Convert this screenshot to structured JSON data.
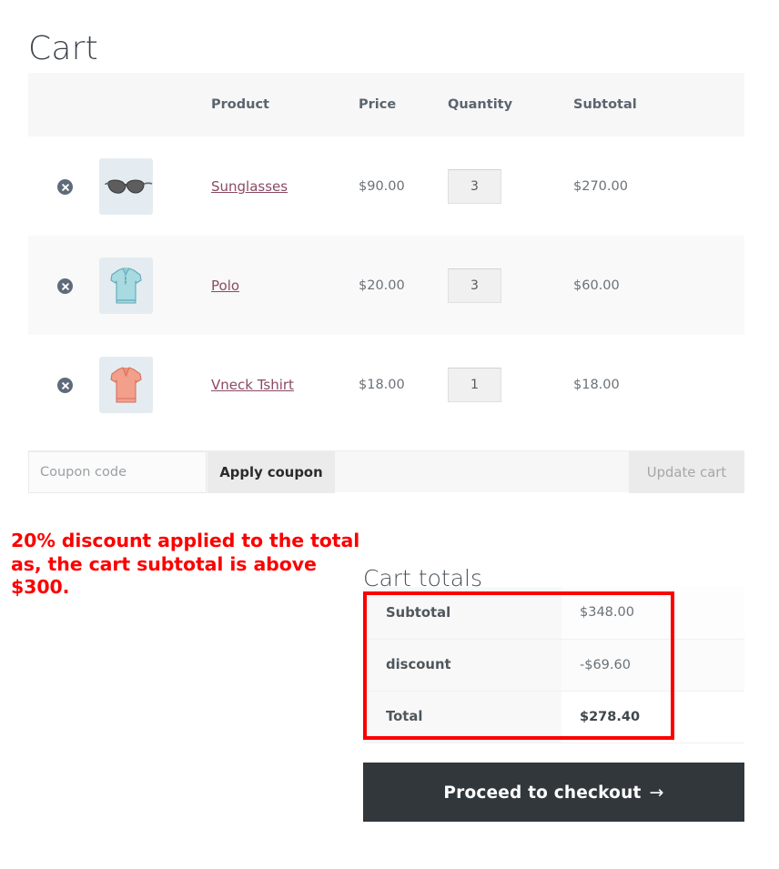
{
  "page": {
    "title": "Cart"
  },
  "cart_table": {
    "columns": [
      "",
      "",
      "Product",
      "Price",
      "Quantity",
      "Subtotal"
    ],
    "headers": {
      "remove": "",
      "thumbnail": "",
      "product": "Product",
      "price": "Price",
      "quantity": "Quantity",
      "subtotal": "Subtotal"
    },
    "rows": [
      {
        "remove_icon": "remove-circle-icon",
        "thumbnail_icon": "sunglasses-thumbnail",
        "name": "Sunglasses",
        "price": "$90.00",
        "quantity": "3",
        "subtotal": "$270.00"
      },
      {
        "remove_icon": "remove-circle-icon",
        "thumbnail_icon": "polo-shirt-thumbnail",
        "name": "Polo",
        "price": "$20.00",
        "quantity": "3",
        "subtotal": "$60.00"
      },
      {
        "remove_icon": "remove-circle-icon",
        "thumbnail_icon": "vneck-tshirt-thumbnail",
        "name": "Vneck Tshirt",
        "price": "$18.00",
        "quantity": "1",
        "subtotal": "$18.00"
      }
    ]
  },
  "actions": {
    "coupon_placeholder": "Coupon code",
    "coupon_value": "",
    "apply_coupon_label": "Apply coupon",
    "update_cart_label": "Update cart"
  },
  "annotation": {
    "text": "20% discount applied to the total as, the cart subtotal is above $300.",
    "color": "#fc0000"
  },
  "cart_totals": {
    "heading": "Cart totals",
    "rows": [
      {
        "label": "Subtotal",
        "value": "$348.00"
      },
      {
        "label": "discount",
        "value": "-$69.60"
      },
      {
        "label": "Total",
        "value": "$278.40"
      }
    ]
  },
  "checkout": {
    "label": "Proceed to checkout",
    "arrow_icon": "arrow-right-icon",
    "arrow_glyph": "→",
    "background": "#32373c"
  }
}
